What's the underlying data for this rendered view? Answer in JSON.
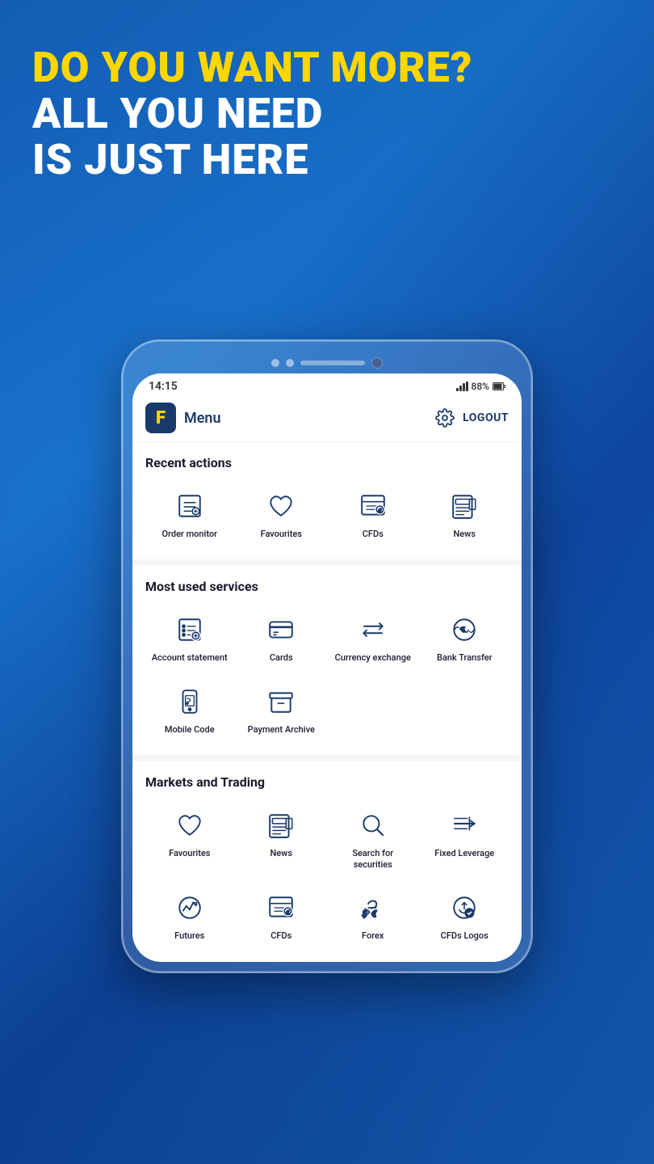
{
  "hero": {
    "line1": "DO YOU WANT MORE?",
    "line2": "ALL YOU NEED",
    "line3": "IS JUST HERE"
  },
  "status": {
    "time": "14:15",
    "signal": "88%",
    "battery": "88%"
  },
  "header": {
    "logo": "F",
    "menu_label": "Menu",
    "logout_label": "LOGOUT"
  },
  "recent_actions": {
    "title": "Recent actions",
    "items": [
      {
        "label": "Order monitor",
        "icon": "order-monitor-icon"
      },
      {
        "label": "Favourites",
        "icon": "heart-icon"
      },
      {
        "label": "CFDs",
        "icon": "cfds-icon"
      },
      {
        "label": "News",
        "icon": "news-icon"
      }
    ]
  },
  "most_used": {
    "title": "Most used services",
    "items": [
      {
        "label": "Account statement",
        "icon": "account-statement-icon"
      },
      {
        "label": "Cards",
        "icon": "cards-icon"
      },
      {
        "label": "Currency exchange",
        "icon": "currency-exchange-icon"
      },
      {
        "label": "Bank Transfer",
        "icon": "bank-transfer-icon"
      },
      {
        "label": "Mobile Code",
        "icon": "mobile-code-icon"
      },
      {
        "label": "Payment Archive",
        "icon": "payment-archive-icon"
      }
    ]
  },
  "markets_trading": {
    "title": "Markets and Trading",
    "items": [
      {
        "label": "Favourites",
        "icon": "heart-icon"
      },
      {
        "label": "News",
        "icon": "news-icon"
      },
      {
        "label": "Search for securities",
        "icon": "search-icon"
      },
      {
        "label": "Fixed Leverage",
        "icon": "fixed-leverage-icon"
      },
      {
        "label": "Futures",
        "icon": "futures-icon"
      },
      {
        "label": "CFDs",
        "icon": "cfds-icon"
      },
      {
        "label": "Forex",
        "icon": "forex-icon"
      },
      {
        "label": "CFDs Logos",
        "icon": "cfds-logos-icon"
      }
    ]
  }
}
